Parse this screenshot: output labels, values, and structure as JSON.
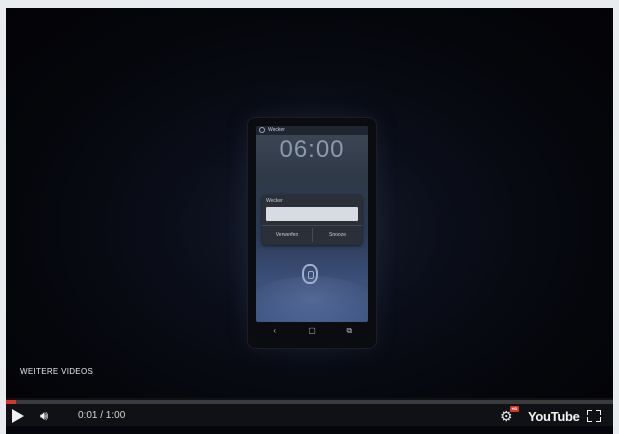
{
  "overlay": {
    "more_videos_label": "WEITERE VIDEOS"
  },
  "player": {
    "time_display": "0:01 / 1:00",
    "progress_percent": 1.7,
    "logo_you": "You",
    "logo_tube": "Tube",
    "hd_badge": "HD"
  },
  "phone": {
    "status_app": "Wecker",
    "clock": "06:00",
    "dialog": {
      "title": "Wecker",
      "dismiss_label": "Verwerfen",
      "snooze_label": "Snooze"
    },
    "nav_icons": [
      "back-icon",
      "home-icon",
      "recent-apps-icon"
    ]
  },
  "colors": {
    "accent_red": "#d8342c",
    "control_bar": "#101114"
  }
}
